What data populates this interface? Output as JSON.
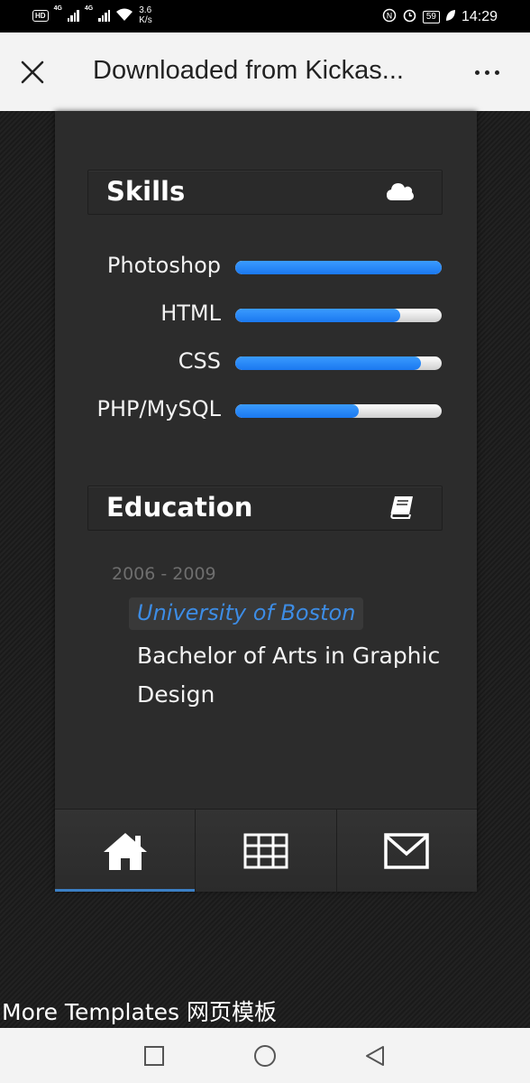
{
  "status_bar": {
    "hd_badge": "HD",
    "network_1": "4G",
    "network_2": "4G",
    "speed_value": "3.6",
    "speed_unit": "K/s",
    "battery": "59",
    "time": "14:29"
  },
  "browser": {
    "title": "Downloaded from Kickas..."
  },
  "skills": {
    "title": "Skills",
    "icon": "cloud-icon",
    "items": [
      {
        "label": "Photoshop",
        "level": 1.0
      },
      {
        "label": "HTML",
        "level": 0.8
      },
      {
        "label": "CSS",
        "level": 0.9
      },
      {
        "label": "PHP/MySQL",
        "level": 0.6
      }
    ]
  },
  "education": {
    "title": "Education",
    "icon": "book-icon",
    "years": "2006 - 2009",
    "school": "University of Boston",
    "degree": "Bachelor of Arts in Graphic Design"
  },
  "bottom_nav": [
    {
      "icon": "home-icon",
      "active": true
    },
    {
      "icon": "grid-icon",
      "active": false
    },
    {
      "icon": "mail-icon",
      "active": false
    }
  ],
  "footer_text": "More Templates 网页模板",
  "colors": {
    "accent": "#3b7fc4",
    "bar_fill": "#1e7cf2",
    "panel": "#2c2c2c"
  }
}
